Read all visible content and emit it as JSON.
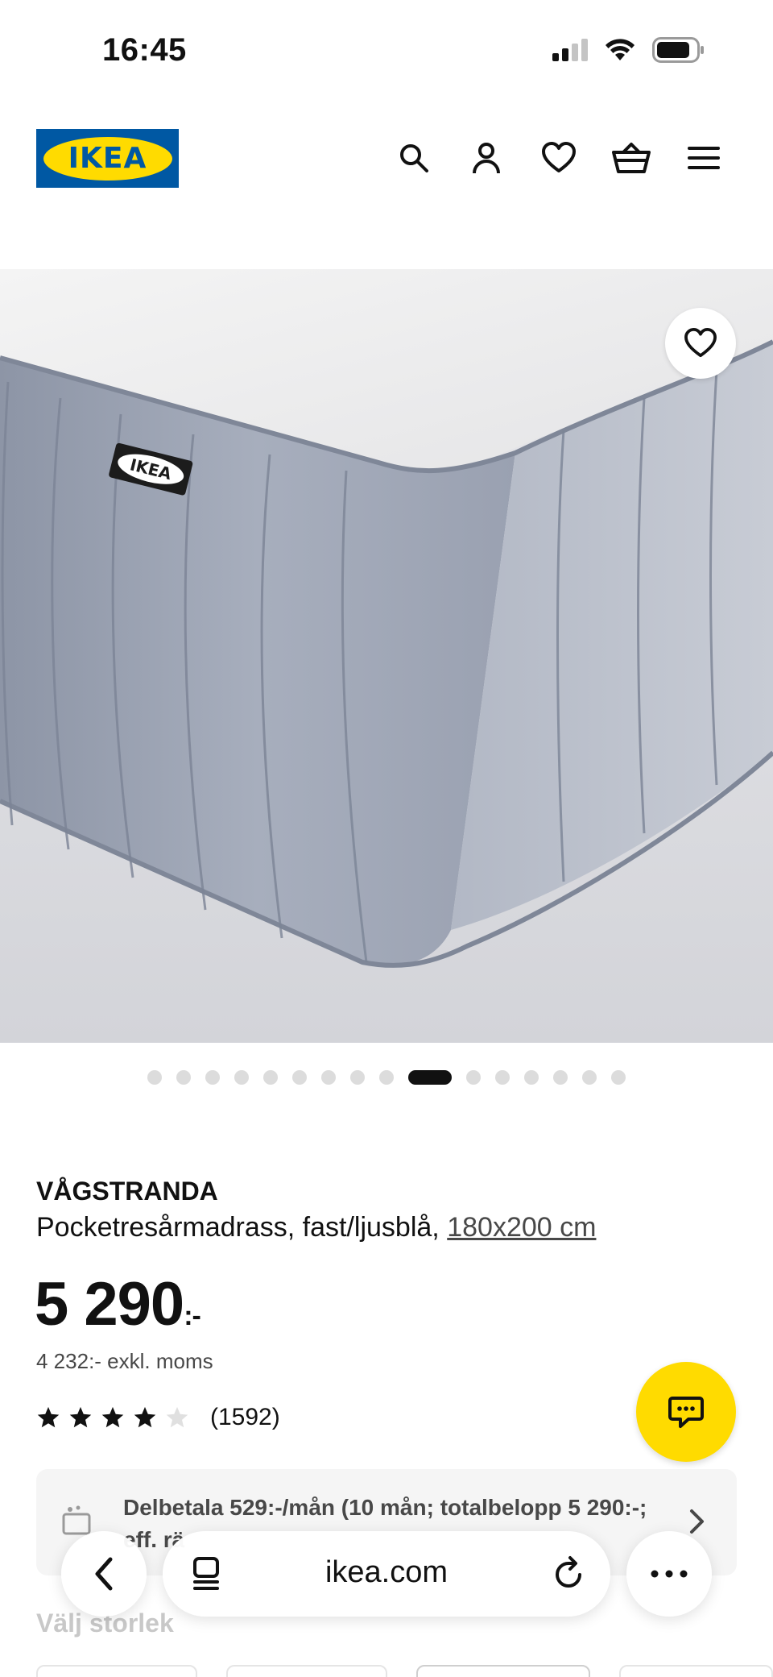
{
  "status_bar": {
    "time": "16:45",
    "icons": [
      "cellular-signal-icon",
      "wifi-icon",
      "battery-icon"
    ]
  },
  "header": {
    "logo_text": "IKEA",
    "icons": [
      "search-icon",
      "account-icon",
      "heart-icon",
      "basket-icon",
      "menu-icon"
    ]
  },
  "product_image": {
    "alt_subject": "mattress corner",
    "tag_text": "IKEA",
    "favorite_icon": "heart-icon"
  },
  "carousel": {
    "total": 16,
    "active_index": 9
  },
  "product": {
    "name": "VÅGSTRANDA",
    "description": "Pocketresårmadrass, fast/ljusblå,",
    "size_link": "180x200 cm",
    "price": "5 290",
    "price_suffix": ":-",
    "price_ex_vat": "4 232:- exkl. moms",
    "rating": 4,
    "rating_max": 5,
    "review_count": "(1592)"
  },
  "financing": {
    "text": "Delbetala 529:-/mån (10 mån; totalbelopp 5 290:-; eff. rä"
  },
  "choose_size_label": "Välj storlek",
  "browser": {
    "url": "ikea.com"
  },
  "colors": {
    "ikea_blue": "#0058a3",
    "ikea_yellow": "#ffdb00",
    "text": "#111111",
    "muted": "#484848"
  }
}
